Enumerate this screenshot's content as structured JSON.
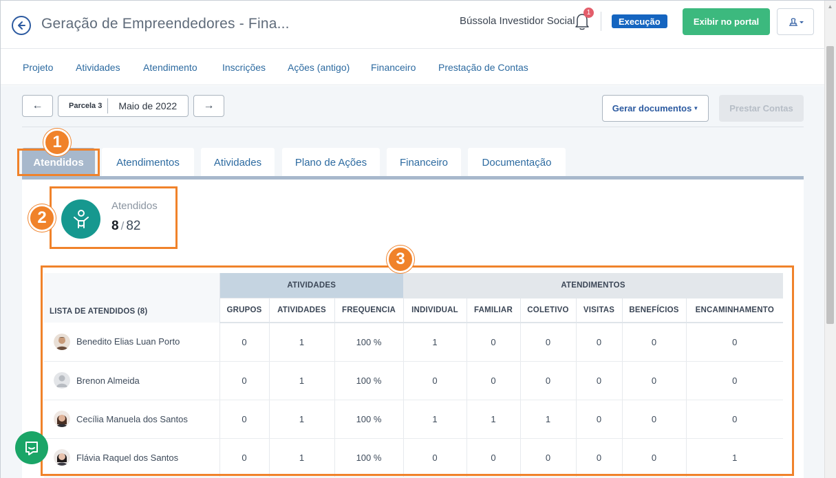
{
  "header": {
    "title": "Geração de Empreendedores - Fina...",
    "org_name": "Bússola Investidor Social",
    "notification_count": "1",
    "status": "Execução",
    "portal_button": "Exibir no portal"
  },
  "nav": {
    "items": [
      "Projeto",
      "Atividades",
      "Atendimento",
      "Inscrições",
      "Ações (antigo)",
      "Financeiro",
      "Prestação de Contas"
    ]
  },
  "toolbar": {
    "prev": "←",
    "next": "→",
    "parcel": "Parcela 3",
    "month": "Maio de 2022",
    "docs_button": "Gerar documentos",
    "accounts_button": "Prestar Contas"
  },
  "tabs": [
    "Atendidos",
    "Atendimentos",
    "Atividades",
    "Plano de Ações",
    "Financeiro",
    "Documentação"
  ],
  "summary": {
    "label": "Atendidos",
    "current": "8",
    "separator": "/",
    "total": "82"
  },
  "table": {
    "list_header": "LISTA DE ATENDIDOS (8)",
    "group_atividades": "ATIVIDADES",
    "group_atendimentos": "ATENDIMENTOS",
    "columns": [
      "GRUPOS",
      "ATIVIDADES",
      "FREQUENCIA",
      "INDIVIDUAL",
      "FAMILIAR",
      "COLETIVO",
      "VISITAS",
      "BENEFÍCIOS",
      "ENCAMINHAMENTO"
    ],
    "rows": [
      {
        "name": "Benedito Elias Luan Porto",
        "avatar": "man",
        "values": [
          "0",
          "1",
          "100 %",
          "1",
          "0",
          "0",
          "0",
          "0",
          "0"
        ]
      },
      {
        "name": "Brenon Almeida",
        "avatar": "placeholder",
        "values": [
          "0",
          "1",
          "100 %",
          "0",
          "0",
          "0",
          "0",
          "0",
          "0"
        ]
      },
      {
        "name": "Cecília Manuela dos Santos",
        "avatar": "woman",
        "values": [
          "0",
          "1",
          "100 %",
          "1",
          "1",
          "1",
          "0",
          "0",
          "0"
        ]
      },
      {
        "name": "Flávia Raquel dos Santos",
        "avatar": "woman",
        "values": [
          "0",
          "1",
          "100 %",
          "0",
          "0",
          "0",
          "0",
          "0",
          "1"
        ]
      }
    ]
  },
  "annotations": [
    "1",
    "2",
    "3"
  ],
  "colors": {
    "accent": "#2c5aa0",
    "status_badge": "#1565c0",
    "portal_green": "#3cb97e",
    "tab_active": "#a7b8cc",
    "summary_teal": "#16988f",
    "annotation_orange": "#f0822a"
  }
}
